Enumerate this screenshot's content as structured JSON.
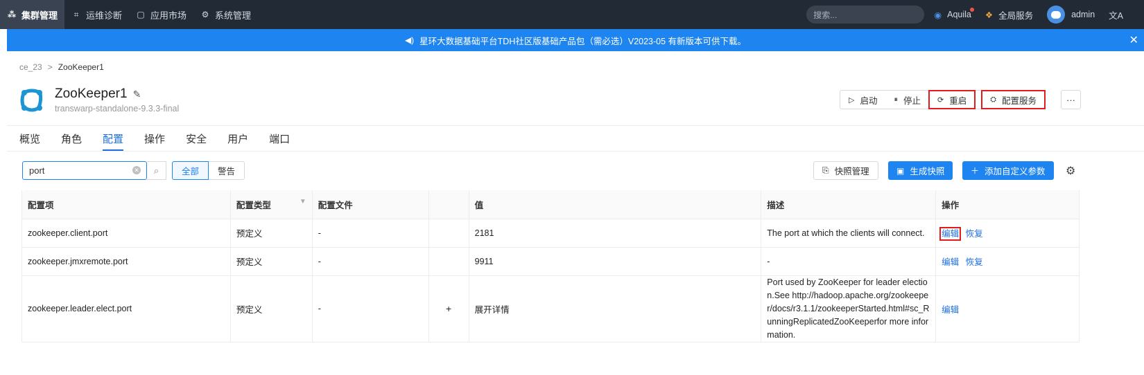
{
  "topnav": {
    "items": [
      {
        "label": "集群管理",
        "icon": "cluster-icon",
        "active": true
      },
      {
        "label": "运维诊断",
        "icon": "diagnose-icon",
        "active": false
      },
      {
        "label": "应用市场",
        "icon": "market-icon",
        "active": false
      },
      {
        "label": "系统管理",
        "icon": "gear-icon",
        "active": false
      }
    ],
    "search_placeholder": "搜索...",
    "aquila_label": "Aquila",
    "global_service_label": "全局服务",
    "user_label": "admin",
    "lang_icon": "translate-icon"
  },
  "banner": {
    "text": "星环大数据基础平台TDH社区版基础产品包（需必选）V2023-05 有新版本可供下载。",
    "icon": "speaker-icon"
  },
  "breadcrumb": {
    "parent": "ce_23",
    "separator": ">",
    "current": "ZooKeeper1"
  },
  "service": {
    "name": "ZooKeeper1",
    "version": "transwarp-standalone-9.3.3-final",
    "actions": {
      "start": "启动",
      "stop": "停止",
      "restart": "重启",
      "configure": "配置服务",
      "more": "···"
    }
  },
  "tabs": [
    "概览",
    "角色",
    "配置",
    "操作",
    "安全",
    "用户",
    "端口"
  ],
  "filter": {
    "search_value": "port",
    "segments": [
      "全部",
      "警告"
    ],
    "snapshot_manage": "快照管理",
    "generate_snapshot": "生成快照",
    "add_custom_param": "添加自定义参数"
  },
  "table": {
    "headers": [
      "配置项",
      "配置类型",
      "配置文件",
      "",
      "值",
      "描述",
      "操作"
    ],
    "rows": [
      {
        "name": "zookeeper.client.port",
        "type": "预定义",
        "file": "-",
        "expand": "",
        "value": "2181",
        "desc": "The port at which the clients will connect.",
        "actions": [
          "编辑",
          "恢复"
        ]
      },
      {
        "name": "zookeeper.jmxremote.port",
        "type": "预定义",
        "file": "-",
        "expand": "",
        "value": "9911",
        "desc": "-",
        "actions": [
          "编辑",
          "恢复"
        ]
      },
      {
        "name": "zookeeper.leader.elect.port",
        "type": "预定义",
        "file": "-",
        "expand": "+",
        "value": "展开详情",
        "desc": "Port used by ZooKeeper for leader election.See http://hadoop.apache.org/zookeeper/docs/r3.1.1/zookeeperStarted.html#sc_RunningReplicatedZooKeeperfor more information.",
        "actions": [
          "编辑"
        ]
      }
    ]
  }
}
